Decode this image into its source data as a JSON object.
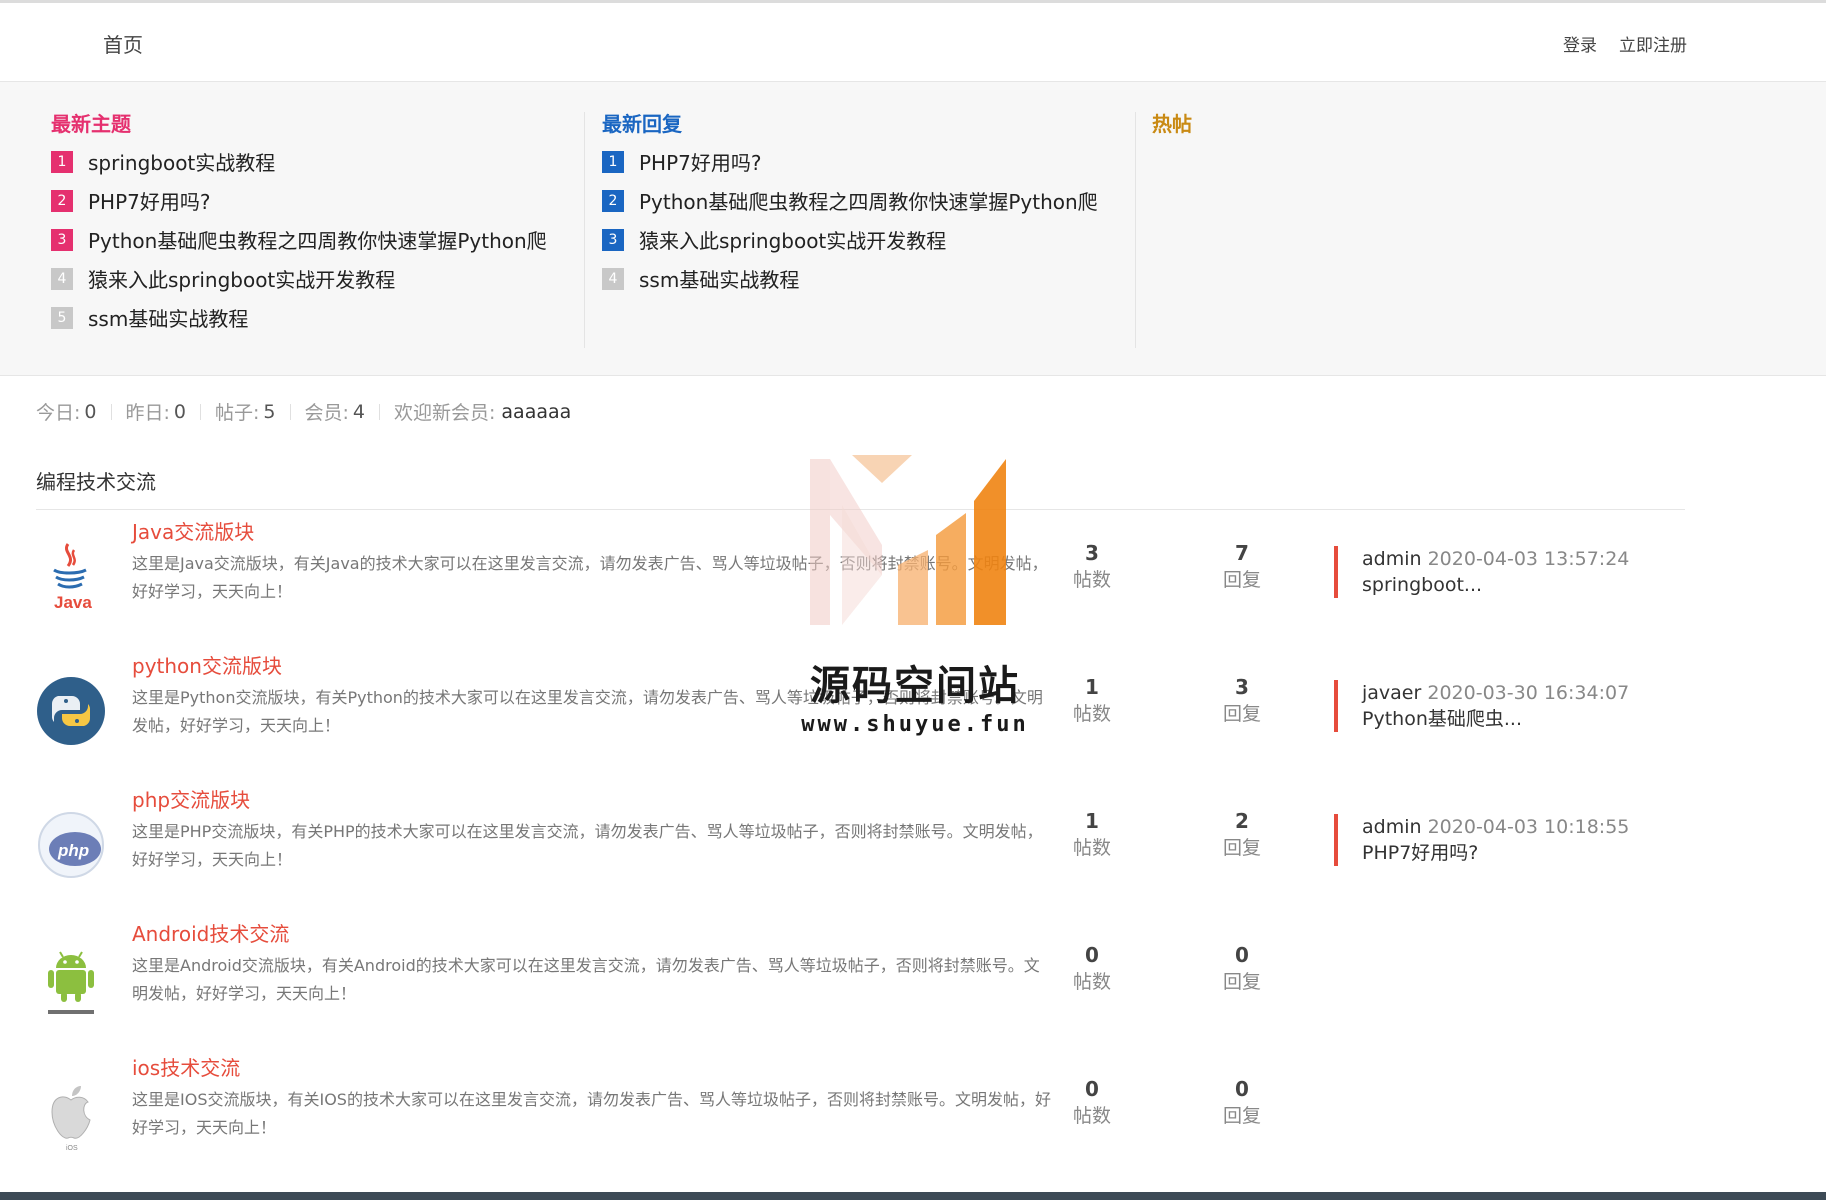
{
  "header": {
    "home_label": "首页",
    "login_label": "登录",
    "register_label": "立即注册"
  },
  "hot": {
    "latest_topics": {
      "title": "最新主题",
      "items": [
        {
          "rank": "1",
          "text": "springboot实战教程"
        },
        {
          "rank": "2",
          "text": "PHP7好用吗?"
        },
        {
          "rank": "3",
          "text": "Python基础爬虫教程之四周教你快速掌握Python爬"
        },
        {
          "rank": "4",
          "text": "猿来入此springboot实战开发教程"
        },
        {
          "rank": "5",
          "text": "ssm基础实战教程"
        }
      ]
    },
    "latest_replies": {
      "title": "最新回复",
      "items": [
        {
          "rank": "1",
          "text": "PHP7好用吗?"
        },
        {
          "rank": "2",
          "text": "Python基础爬虫教程之四周教你快速掌握Python爬"
        },
        {
          "rank": "3",
          "text": "猿来入此springboot实战开发教程"
        },
        {
          "rank": "4",
          "text": "ssm基础实战教程"
        }
      ]
    },
    "hot_posts": {
      "title": "热帖"
    }
  },
  "stats": {
    "today_label": "今日:",
    "today_value": "0",
    "yesterday_label": "昨日:",
    "yesterday_value": "0",
    "posts_label": "帖子:",
    "posts_value": "5",
    "members_label": "会员:",
    "members_value": "4",
    "welcome_label": "欢迎新会员:",
    "welcome_name": "aaaaaa"
  },
  "section": {
    "title": "编程技术交流"
  },
  "forums": [
    {
      "name": "Java交流版块",
      "icon": "java-icon",
      "description": "这里是Java交流版块，有关Java的技术大家可以在这里发言交流，请勿发表广告、骂人等垃圾帖子，否则将封禁账号。文明发帖，好好学习，天天向上！",
      "posts": "3",
      "posts_label": "帖数",
      "replies": "7",
      "replies_label": "回复",
      "last_user": "admin",
      "last_time": "2020-04-03 13:57:24",
      "last_title": "springboot..."
    },
    {
      "name": "python交流版块",
      "icon": "python-icon",
      "description": "这里是Python交流版块，有关Python的技术大家可以在这里发言交流，请勿发表广告、骂人等垃圾帖子，否则将封禁账号。文明发帖，好好学习，天天向上！",
      "posts": "1",
      "posts_label": "帖数",
      "replies": "3",
      "replies_label": "回复",
      "last_user": "javaer",
      "last_time": "2020-03-30 16:34:07",
      "last_title": "Python基础爬虫..."
    },
    {
      "name": "php交流版块",
      "icon": "php-icon",
      "description": "这里是PHP交流版块，有关PHP的技术大家可以在这里发言交流，请勿发表广告、骂人等垃圾帖子，否则将封禁账号。文明发帖，好好学习，天天向上！",
      "posts": "1",
      "posts_label": "帖数",
      "replies": "2",
      "replies_label": "回复",
      "last_user": "admin",
      "last_time": "2020-04-03 10:18:55",
      "last_title": "PHP7好用吗?"
    },
    {
      "name": "Android技术交流",
      "icon": "android-icon",
      "description": "这里是Android交流版块，有关Android的技术大家可以在这里发言交流，请勿发表广告、骂人等垃圾帖子，否则将封禁账号。文明发帖，好好学习，天天向上！",
      "posts": "0",
      "posts_label": "帖数",
      "replies": "0",
      "replies_label": "回复"
    },
    {
      "name": "ios技术交流",
      "icon": "apple-icon",
      "description": "这里是IOS交流版块，有关IOS的技术大家可以在这里发言交流，请勿发表广告、骂人等垃圾帖子，否则将封禁账号。文明发帖，好好学习，天天向上！",
      "posts": "0",
      "posts_label": "帖数",
      "replies": "0",
      "replies_label": "回复"
    }
  ],
  "watermark": {
    "text": "源码空间站",
    "url": "www.shuyue.fun"
  },
  "colors": {
    "accent_red": "#e64c3c",
    "pink": "#e5306f",
    "blue": "#1a66c2",
    "gold": "#c98a14"
  }
}
